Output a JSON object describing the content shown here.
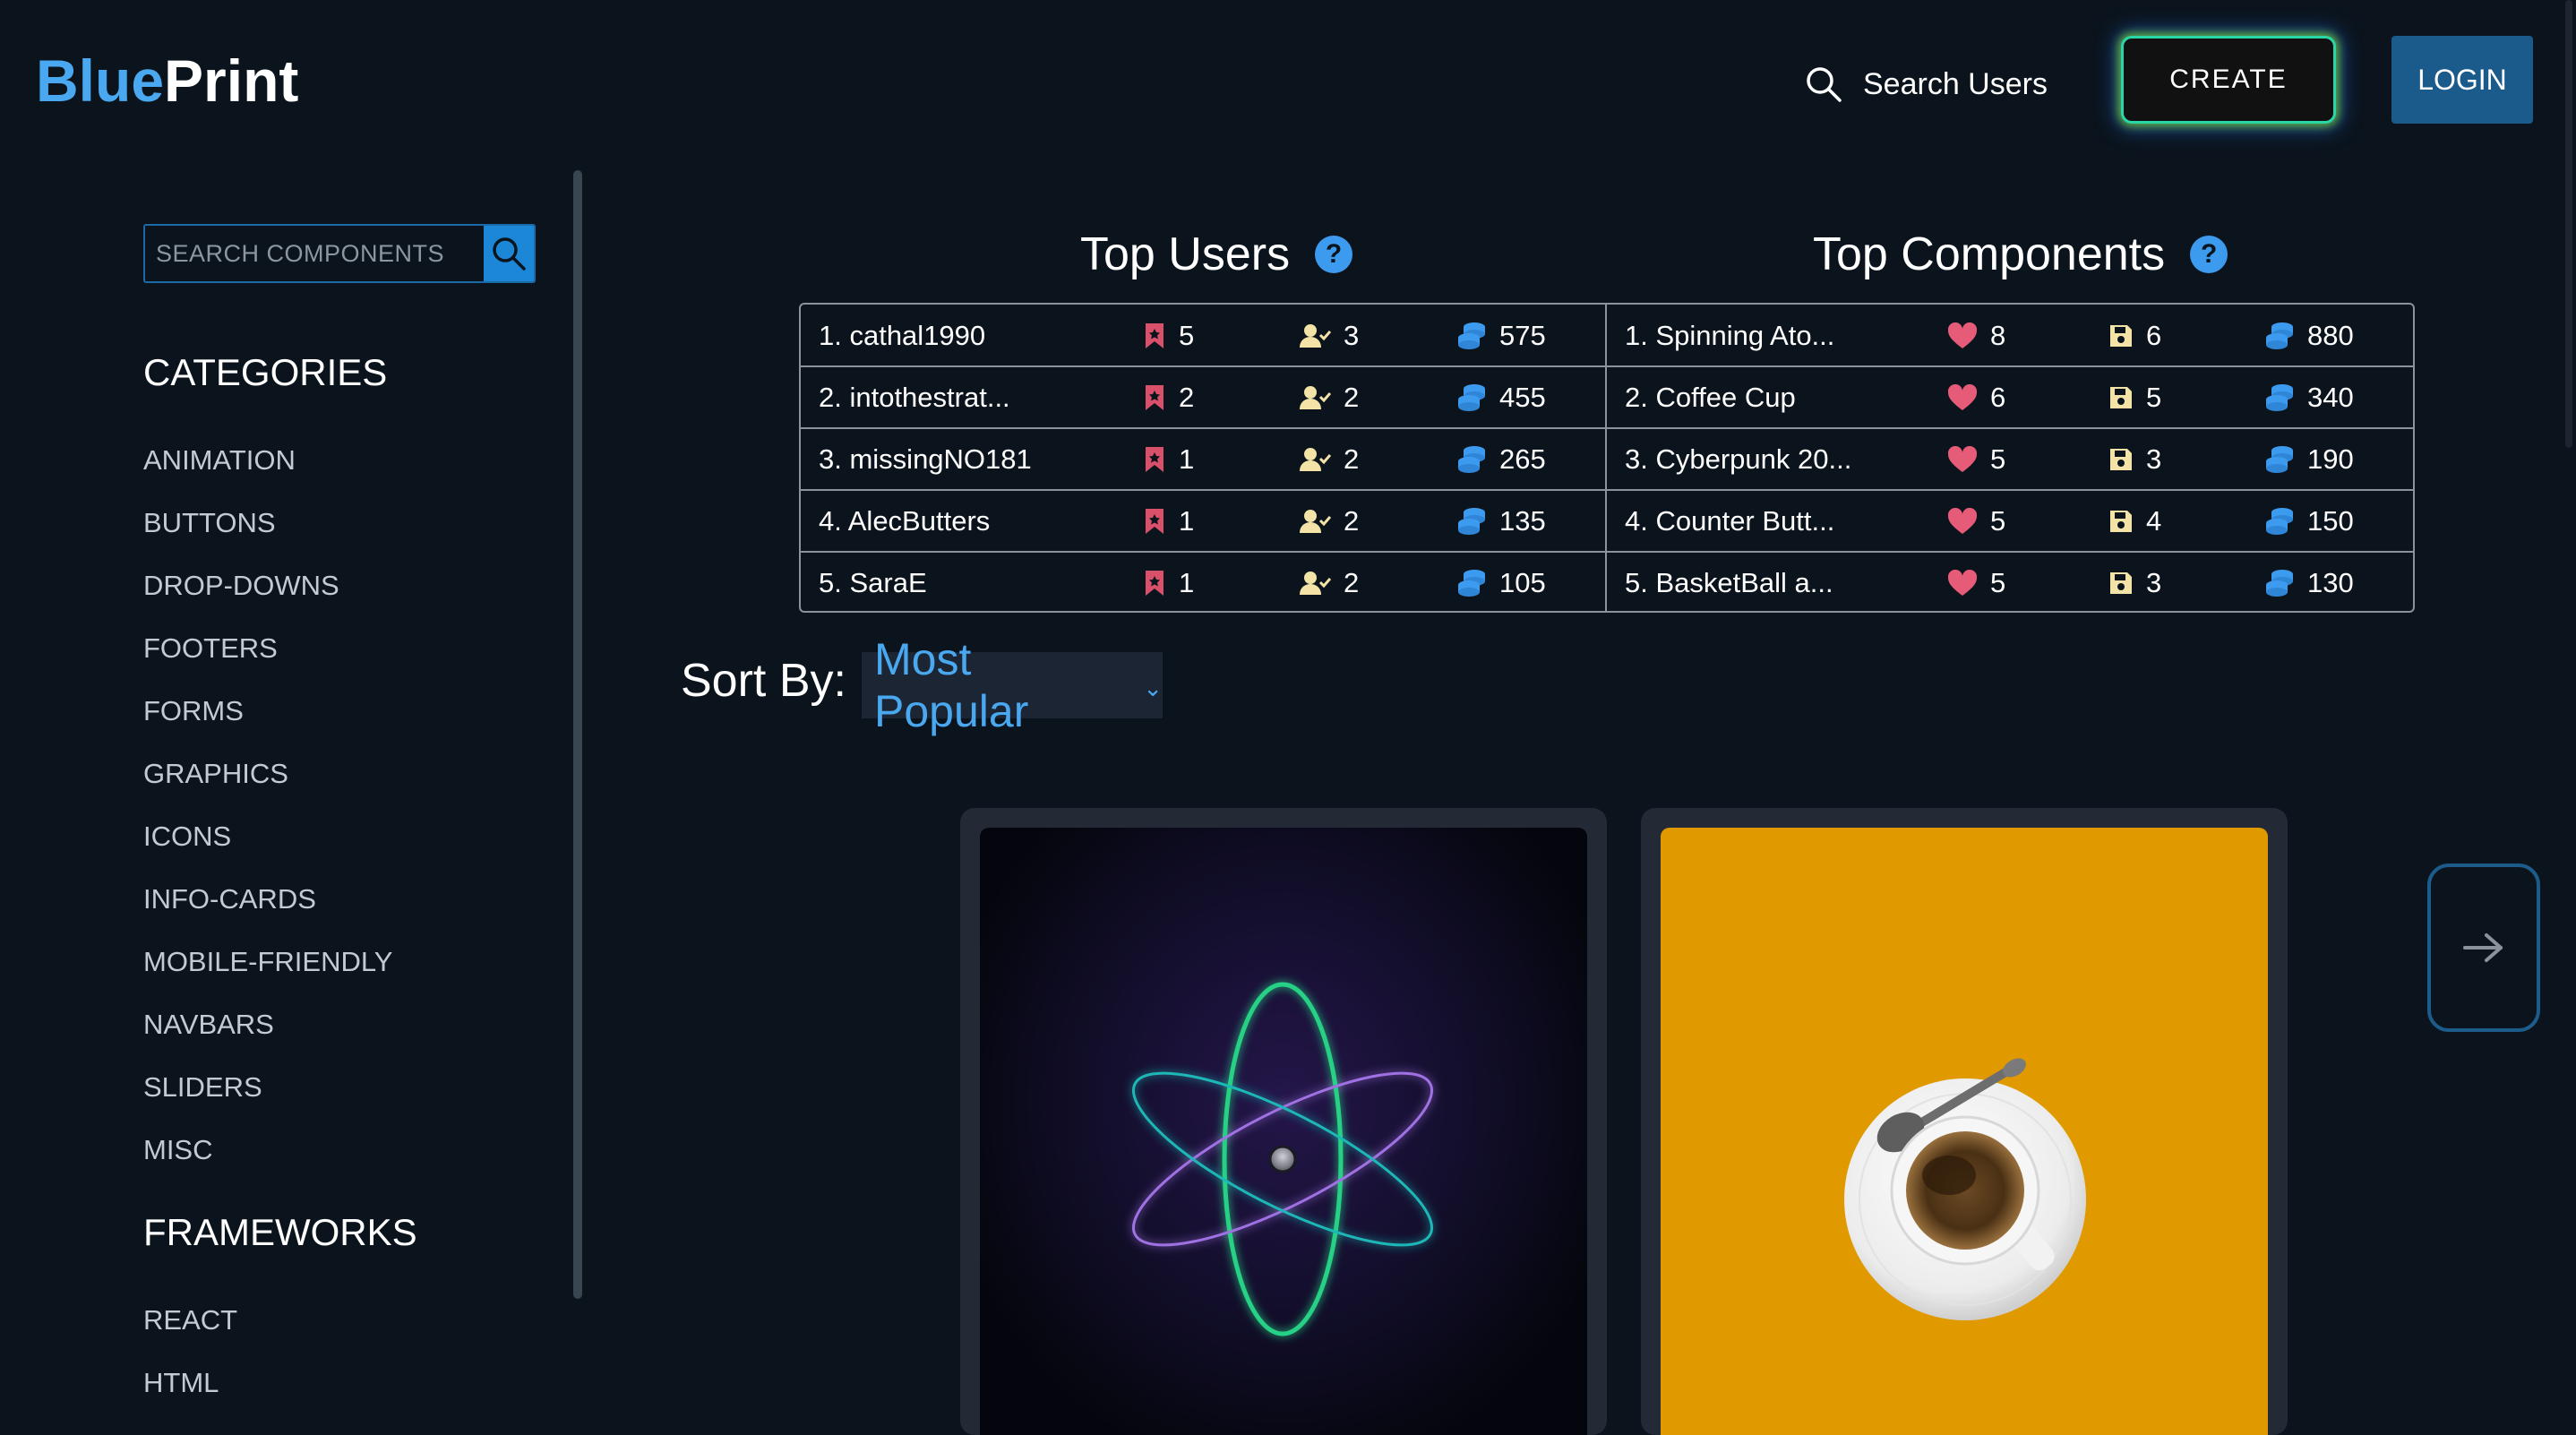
{
  "brand": {
    "part1": "Blue",
    "part2": "Print",
    "colors": {
      "blue": "#4aa8f0",
      "white": "#ffffff"
    }
  },
  "header": {
    "search_users_label": "Search Users",
    "create_label": "CREATE",
    "login_label": "LOGIN"
  },
  "sidebar": {
    "search_placeholder": "SEARCH COMPONENTS",
    "categories_heading": "CATEGORIES",
    "categories": [
      "ANIMATION",
      "BUTTONS",
      "DROP-DOWNS",
      "FOOTERS",
      "FORMS",
      "GRAPHICS",
      "ICONS",
      "INFO-CARDS",
      "MOBILE-FRIENDLY",
      "NAVBARS",
      "SLIDERS",
      "MISC"
    ],
    "frameworks_heading": "FRAMEWORKS",
    "frameworks": [
      "REACT",
      "HTML"
    ]
  },
  "top_users": {
    "title": "Top Users",
    "help": "?",
    "rows": [
      {
        "name": "1. cathal1990",
        "bookmarks": "5",
        "followers": "3",
        "coins": "575"
      },
      {
        "name": "2. intothestrat...",
        "bookmarks": "2",
        "followers": "2",
        "coins": "455"
      },
      {
        "name": "3. missingNO181",
        "bookmarks": "1",
        "followers": "2",
        "coins": "265"
      },
      {
        "name": "4. AlecButters",
        "bookmarks": "1",
        "followers": "2",
        "coins": "135"
      },
      {
        "name": "5. SaraE",
        "bookmarks": "1",
        "followers": "2",
        "coins": "105"
      }
    ]
  },
  "top_components": {
    "title": "Top Components",
    "help": "?",
    "rows": [
      {
        "name": "1. Spinning Ato...",
        "likes": "8",
        "saves": "6",
        "coins": "880"
      },
      {
        "name": "2. Coffee Cup",
        "likes": "6",
        "saves": "5",
        "coins": "340"
      },
      {
        "name": "3. Cyberpunk 20...",
        "likes": "5",
        "saves": "3",
        "coins": "190"
      },
      {
        "name": "4. Counter Butt...",
        "likes": "5",
        "saves": "4",
        "coins": "150"
      },
      {
        "name": "5. BasketBall a...",
        "likes": "5",
        "saves": "3",
        "coins": "130"
      }
    ]
  },
  "sort": {
    "label": "Sort By:",
    "selected": "Most Popular"
  },
  "icons": {
    "bookmark": "bookmark-icon",
    "follower": "user-check-icon",
    "coins": "coins-icon",
    "like": "heart-icon",
    "save": "floppy-disk-icon",
    "search": "search-icon",
    "next": "arrow-right-icon"
  },
  "accent_colors": {
    "bookmark": "#d9506b",
    "follower": "#f3e3a7",
    "coins": "#3d9bef",
    "heart": "#e65b78",
    "save": "#f3e3a7",
    "card_bg_coffee": "#e09a00"
  }
}
